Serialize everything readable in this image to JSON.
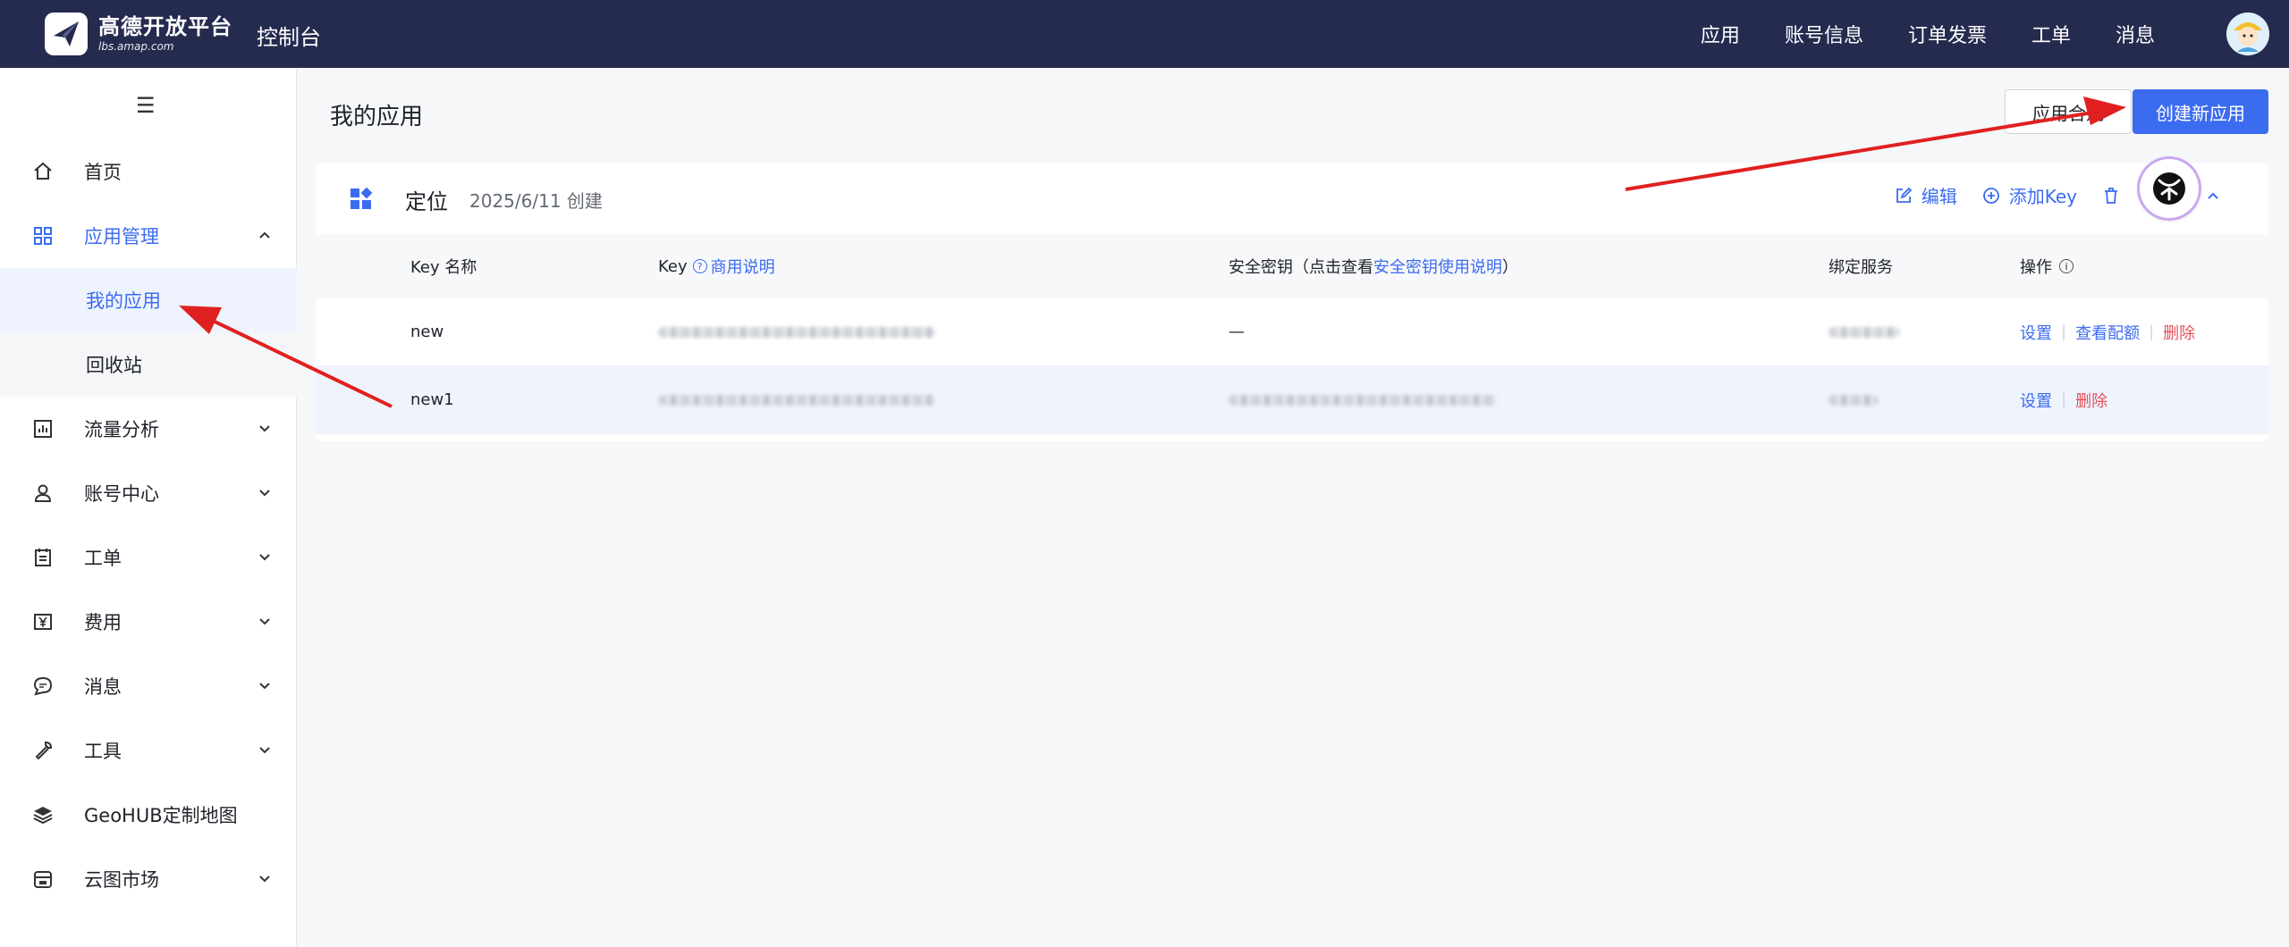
{
  "header": {
    "brand_title": "高德开放平台",
    "brand_sub": "lbs.amap.com",
    "console": "控制台",
    "nav": [
      "应用",
      "账号信息",
      "订单发票",
      "工单",
      "消息"
    ]
  },
  "sidebar": {
    "items": [
      {
        "label": "首页",
        "icon": "home-icon"
      },
      {
        "label": "应用管理",
        "icon": "grid-icon",
        "expanded": true,
        "children": [
          {
            "label": "我的应用",
            "active": true
          },
          {
            "label": "回收站"
          }
        ]
      },
      {
        "label": "流量分析",
        "icon": "chart-icon"
      },
      {
        "label": "账号中心",
        "icon": "user-icon"
      },
      {
        "label": "工单",
        "icon": "ticket-icon"
      },
      {
        "label": "费用",
        "icon": "yen-icon"
      },
      {
        "label": "消息",
        "icon": "message-icon"
      },
      {
        "label": "工具",
        "icon": "wrench-icon"
      },
      {
        "label": "GeoHUB定制地图",
        "icon": "layers-icon"
      },
      {
        "label": "云图市场",
        "icon": "store-icon"
      }
    ]
  },
  "main": {
    "title": "我的应用",
    "compliance_btn": "应用合规",
    "create_btn": "创建新应用",
    "app": {
      "name": "定位",
      "created": "2025/6/11 创建",
      "actions": {
        "edit": "编辑",
        "add_key": "添加Key"
      }
    },
    "table": {
      "headers": {
        "key_name": "Key 名称",
        "key": "Key",
        "key_link": "商用说明",
        "secret_prefix": "安全密钥（点击查看",
        "secret_link": "安全密钥使用说明",
        "secret_suffix": "）",
        "service": "绑定服务",
        "ops": "操作"
      },
      "rows": [
        {
          "name": "new",
          "secret": "—",
          "ops": [
            "设置",
            "查看配额",
            "删除"
          ]
        },
        {
          "name": "new1",
          "ops": [
            "设置",
            "删除"
          ]
        }
      ]
    }
  },
  "colors": {
    "accent": "#3b6cf0",
    "header_bg": "#252a4f",
    "danger": "#e8505b",
    "arrow": "#e02020"
  }
}
